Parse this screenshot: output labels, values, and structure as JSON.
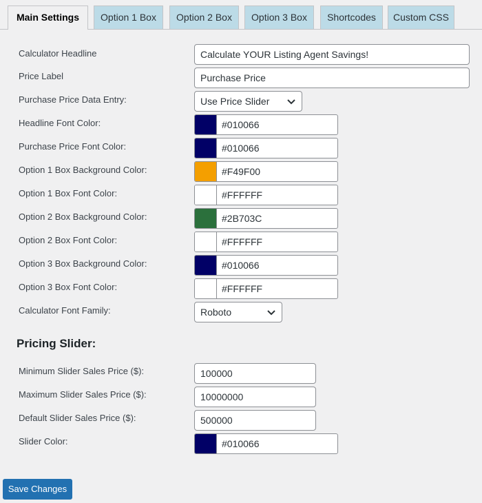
{
  "tabs": [
    {
      "label": "Main Settings"
    },
    {
      "label": "Option 1 Box"
    },
    {
      "label": "Option 2 Box"
    },
    {
      "label": "Option 3 Box"
    },
    {
      "label": "Shortcodes"
    },
    {
      "label": "Custom CSS"
    }
  ],
  "main": {
    "headline_label": "Calculator Headline",
    "headline_value": "Calculate YOUR Listing Agent Savings!",
    "price_label_label": "Price Label",
    "price_label_value": "Purchase Price",
    "data_entry_label": "Purchase Price Data Entry:",
    "data_entry_value": "Use Price Slider",
    "colors": [
      {
        "label": "Headline Font Color:",
        "hex": "#010066",
        "color": "#010066"
      },
      {
        "label": "Purchase Price Font Color:",
        "hex": "#010066",
        "color": "#010066"
      },
      {
        "label": "Option 1 Box Background Color:",
        "hex": "#F49F00",
        "color": "#F49F00"
      },
      {
        "label": "Option 1 Box Font Color:",
        "hex": "#FFFFFF",
        "color": "#FFFFFF"
      },
      {
        "label": "Option 2 Box Background Color:",
        "hex": "#2B703C",
        "color": "#2B703C"
      },
      {
        "label": "Option 2 Box Font Color:",
        "hex": "#FFFFFF",
        "color": "#FFFFFF"
      },
      {
        "label": "Option 3 Box Background Color:",
        "hex": "#010066",
        "color": "#010066"
      },
      {
        "label": "Option 3 Box Font Color:",
        "hex": "#FFFFFF",
        "color": "#FFFFFF"
      }
    ],
    "font_family_label": "Calculator Font Family:",
    "font_family_value": "Roboto"
  },
  "pricing": {
    "section_title": "Pricing Slider:",
    "min_label": "Minimum Slider Sales Price ($):",
    "min_value": "100000",
    "max_label": "Maximum Slider Sales Price ($):",
    "max_value": "10000000",
    "default_label": "Default Slider Sales Price ($):",
    "default_value": "500000",
    "slider_color_label": "Slider Color:",
    "slider_color_hex": "#010066",
    "slider_color": "#010066"
  },
  "save_label": "Save Changes",
  "icons": {
    "dropdown": "chevron-down-icon"
  }
}
